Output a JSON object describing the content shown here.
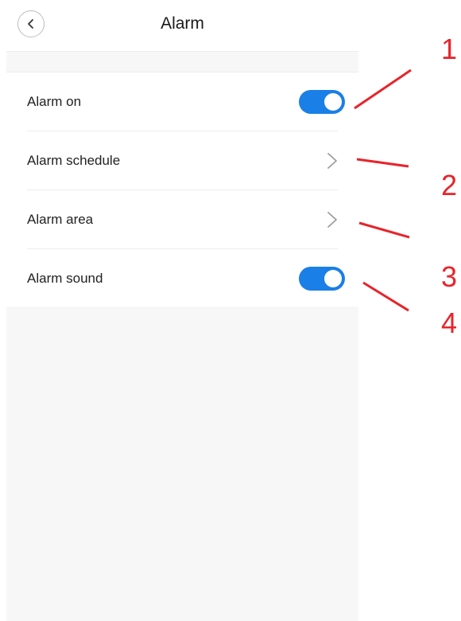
{
  "header": {
    "title": "Alarm",
    "back_icon": "chevron-left-icon"
  },
  "settings": [
    {
      "label": "Alarm on",
      "control": "toggle",
      "state": "on"
    },
    {
      "label": "Alarm schedule",
      "control": "chevron",
      "icon": "chevron-right-icon"
    },
    {
      "label": "Alarm area",
      "control": "chevron",
      "icon": "chevron-right-icon"
    },
    {
      "label": "Alarm sound",
      "control": "toggle",
      "state": "on"
    }
  ],
  "annotations": {
    "numbers": [
      "1",
      "2",
      "3",
      "4"
    ],
    "color": "#e8242b"
  },
  "colors": {
    "toggle_on": "#1a7fe6",
    "chevron": "#9e9e9e",
    "background": "#f7f7f7"
  }
}
